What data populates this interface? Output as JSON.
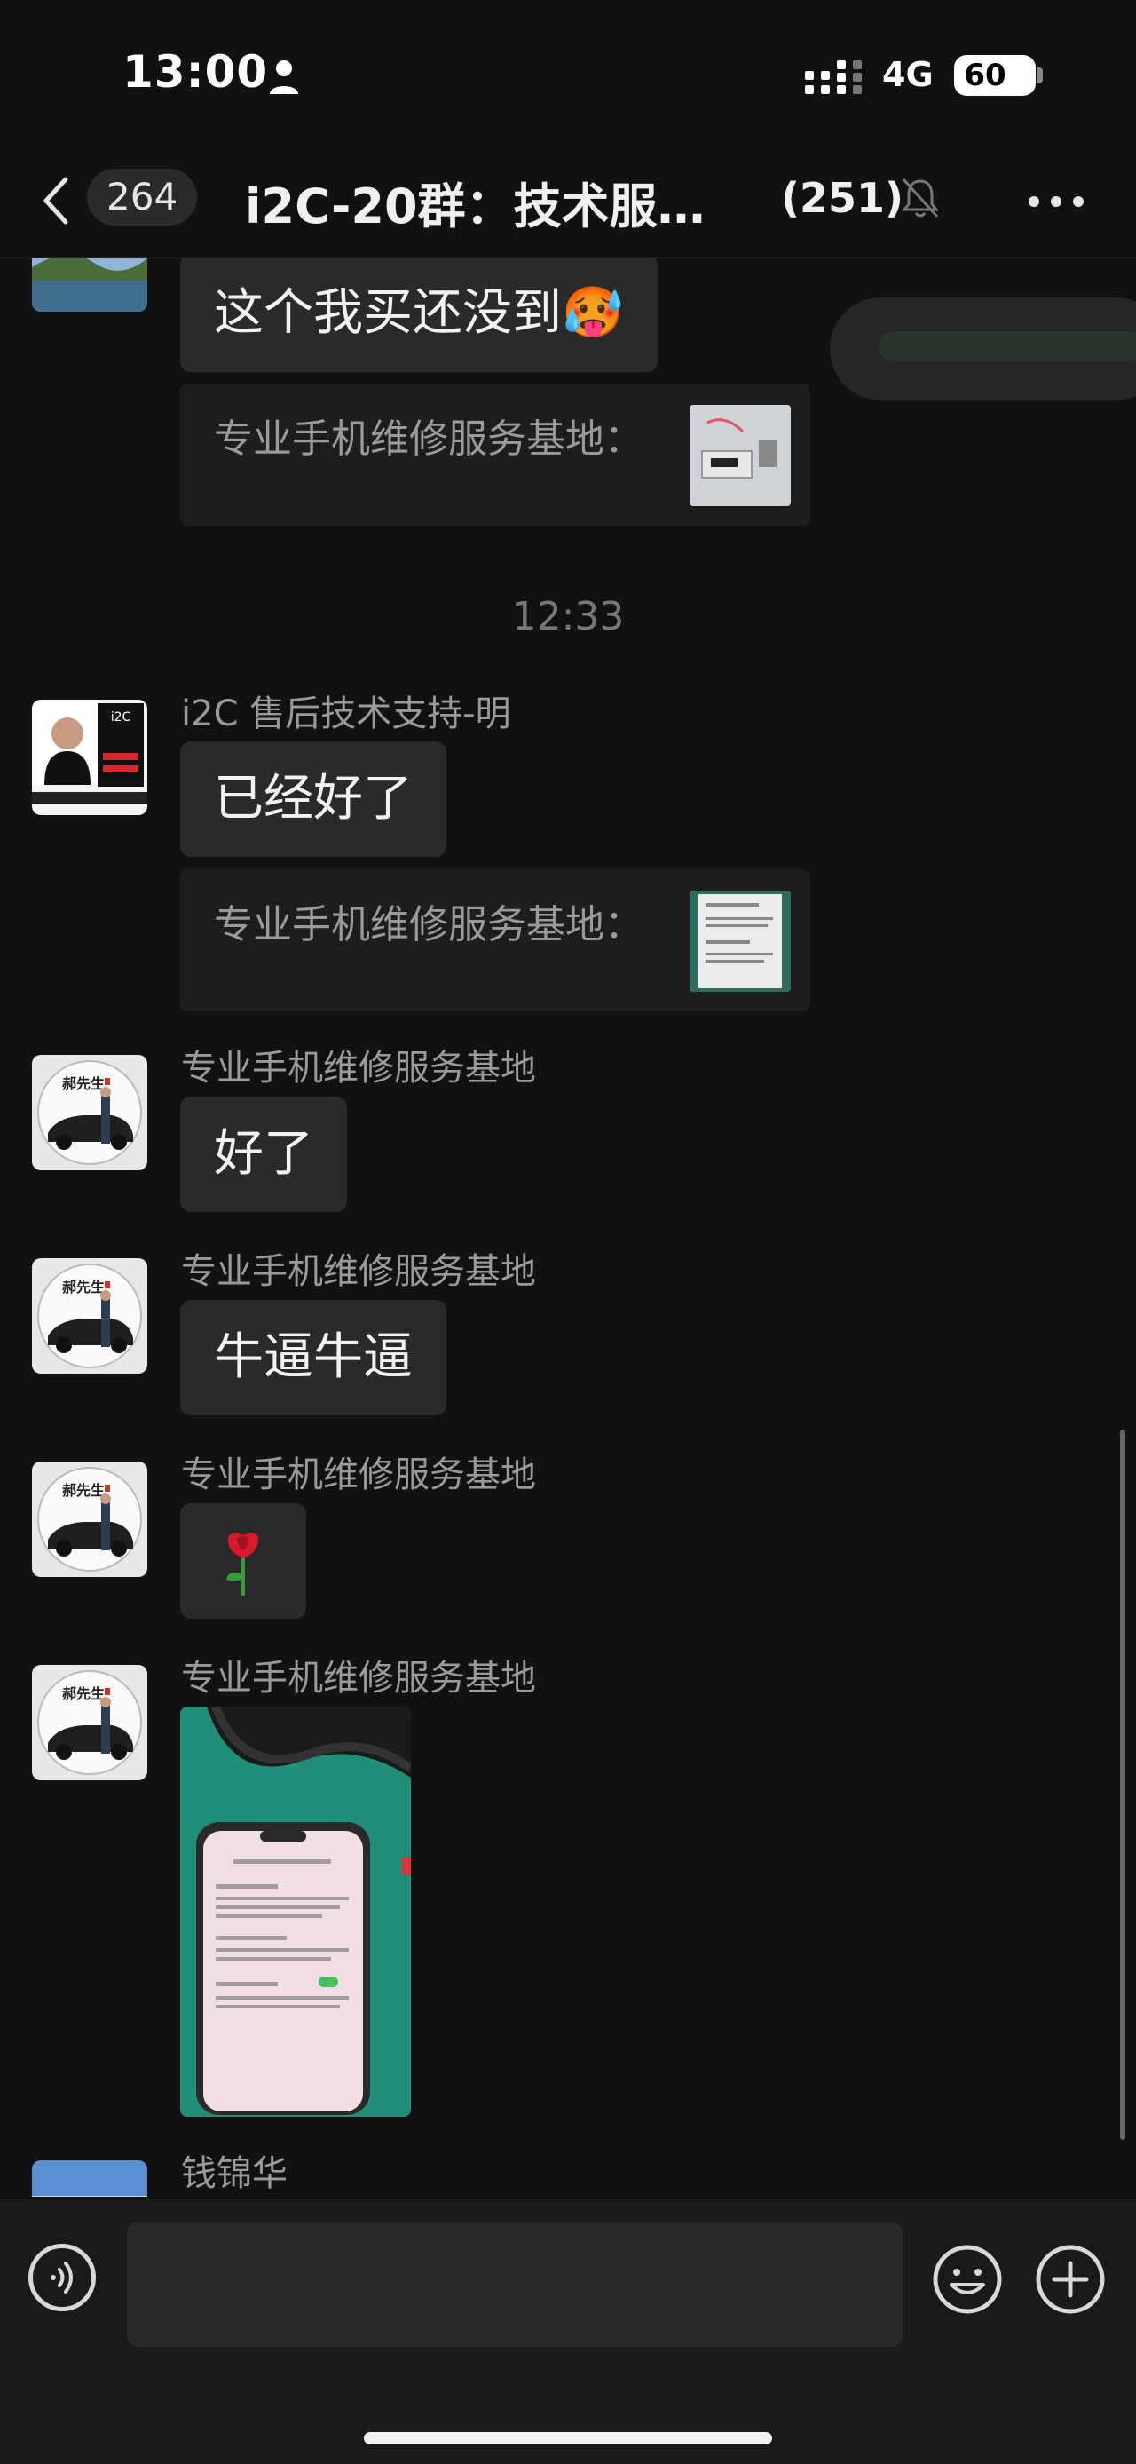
{
  "status_bar": {
    "time": "13:00",
    "network": "4G",
    "battery": "60"
  },
  "header": {
    "unread_count": "264",
    "title": "i2C-20群：技术服…",
    "member_count": "(251)"
  },
  "messages": [
    {
      "type": "text",
      "text": "这个我买还没到🥵"
    },
    {
      "type": "quote",
      "text": "专业手机维修服务基地："
    },
    {
      "type": "time",
      "text": "12:33"
    },
    {
      "type": "text",
      "sender": "i2C 售后技术支持-明",
      "text": "已经好了"
    },
    {
      "type": "quote",
      "text": "专业手机维修服务基地："
    },
    {
      "type": "text",
      "sender": "专业手机维修服务基地",
      "text": "好了"
    },
    {
      "type": "text",
      "sender": "专业手机维修服务基地",
      "text": "牛逼牛逼"
    },
    {
      "type": "text",
      "sender": "专业手机维修服务基地",
      "text": "🌹"
    },
    {
      "type": "image",
      "sender": "专业手机维修服务基地"
    },
    {
      "type": "text",
      "sender": "钱锦华"
    }
  ],
  "avatar_badge": {
    "label": "i2C"
  },
  "avatar_text": "郝先生",
  "colors": {
    "background": "#111111",
    "bubble": "#2a2a2a",
    "accent": "#e6e6e6"
  }
}
